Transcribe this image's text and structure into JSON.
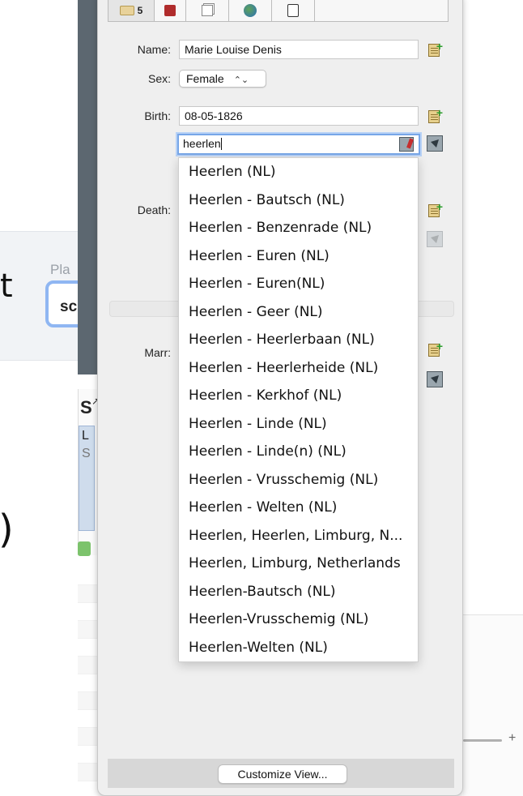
{
  "background": {
    "t_glyph": "t",
    "place_label_partial": "Pla",
    "input_partial": "sc",
    "panel_s": "S",
    "panel_l": "L",
    "panel_s2": "S",
    "paren": ")"
  },
  "tabs": [
    {
      "icon": "note-icon",
      "label": "5"
    },
    {
      "icon": "book-icon",
      "label": ""
    },
    {
      "icon": "pages-icon",
      "label": ""
    },
    {
      "icon": "globe-icon",
      "label": ""
    },
    {
      "icon": "page-icon",
      "label": ""
    }
  ],
  "form": {
    "name_label": "Name:",
    "name_value": "Marie Louise Denis",
    "sex_label": "Sex:",
    "sex_value": "Female",
    "birth_label": "Birth:",
    "birth_date": "08-05-1826",
    "birth_place": "heerlen",
    "death_label": "Death:",
    "marr_label": "Marr:"
  },
  "place_suggestions": [
    "Heerlen (NL)",
    "Heerlen - Bautsch (NL)",
    "Heerlen - Benzenrade (NL)",
    "Heerlen - Euren (NL)",
    "Heerlen - Euren(NL)",
    "Heerlen - Geer (NL)",
    "Heerlen - Heerlerbaan (NL)",
    "Heerlen - Heerlerheide  (NL)",
    "Heerlen - Kerkhof (NL)",
    "Heerlen - Linde (NL)",
    "Heerlen - Linde(n) (NL)",
    "Heerlen - Vrusschemig (NL)",
    "Heerlen - Welten (NL)",
    "Heerlen, Heerlen, Limburg, N...",
    "Heerlen, Limburg, Netherlands",
    "Heerlen-Bautsch (NL)",
    "Heerlen-Vrusschemig (NL)",
    "Heerlen-Welten (NL)"
  ],
  "footer": {
    "customize_label": "Customize View..."
  },
  "slider_plus": "+"
}
